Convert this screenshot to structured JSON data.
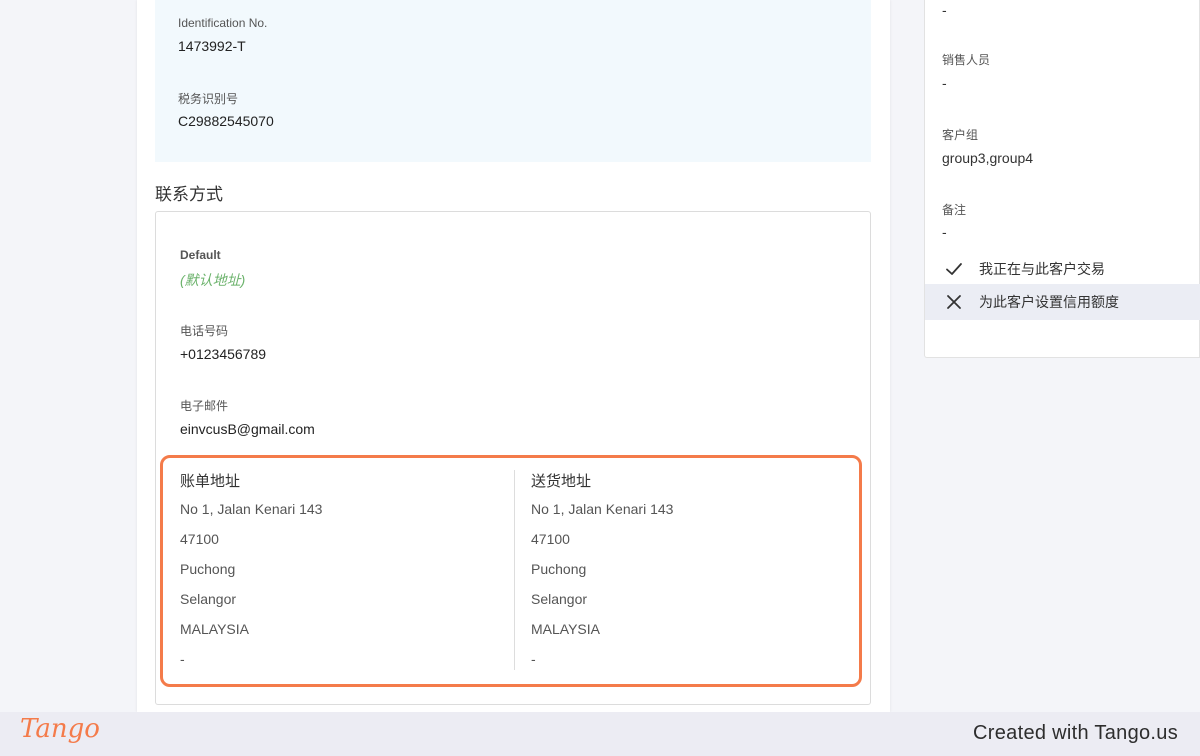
{
  "id_card": {
    "identification_label": "Identification No.",
    "identification_value": "1473992-T",
    "tax_label": "税务识别号",
    "tax_value": "C29882545070"
  },
  "contact": {
    "section_title": "联系方式",
    "default_label": "Default",
    "default_sub": "(默认地址)",
    "phone_label": "电话号码",
    "phone_value": "+0123456789",
    "email_label": "电子邮件",
    "email_value": "einvcusB@gmail.com"
  },
  "billing": {
    "title": "账单地址",
    "lines": [
      "No 1, Jalan Kenari 143",
      "47100",
      "Puchong",
      "Selangor",
      "MALAYSIA",
      "-"
    ]
  },
  "shipping": {
    "title": "送货地址",
    "lines": [
      "No 1, Jalan Kenari 143",
      "47100",
      "Puchong",
      "Selangor",
      "MALAYSIA",
      "-"
    ]
  },
  "right_panel": {
    "top_value": "-",
    "salesperson_label": "销售人员",
    "salesperson_value": "-",
    "customer_group_label": "客户组",
    "customer_group_value": "group3,group4",
    "notes_label": "备注",
    "notes_value": "-",
    "trading_label": "我正在与此客户交易",
    "credit_limit_label": "为此客户设置信用额度"
  },
  "icons": {
    "trading": "check-icon",
    "credit_limit": "close-icon"
  },
  "footer": {
    "logo_text": "Tango",
    "credit_text": "Created with Tango.us"
  },
  "colors": {
    "highlight": "#f47b4a",
    "default_sub": "#6cb36c",
    "id_card_bg": "#f2f9fd"
  }
}
